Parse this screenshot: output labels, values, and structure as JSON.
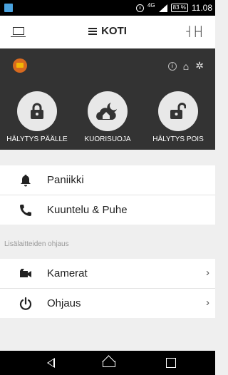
{
  "status_bar": {
    "network": "4G",
    "battery": "83 %",
    "time": "11.08"
  },
  "app_bar": {
    "title": "KOTI"
  },
  "panel": {
    "modes": [
      {
        "label": "HÄLYTYS PÄÄLLE",
        "icon": "lock-closed-icon"
      },
      {
        "label": "KUORISUOJA",
        "icon": "home-night-icon"
      },
      {
        "label": "HÄLYTYS POIS",
        "icon": "lock-open-icon"
      }
    ]
  },
  "list1": {
    "items": [
      {
        "label": "Paniikki",
        "icon": "bell-icon"
      },
      {
        "label": "Kuuntelu & Puhe",
        "icon": "phone-icon"
      }
    ]
  },
  "section_header": "Lisälaitteiden ohjaus",
  "list2": {
    "items": [
      {
        "label": "Kamerat",
        "icon": "camera-icon"
      },
      {
        "label": "Ohjaus",
        "icon": "power-icon"
      }
    ]
  },
  "colors": {
    "panel_bg": "#333333",
    "circle_bg": "#e8e8e8",
    "accent_logo": "#d86a1f"
  }
}
